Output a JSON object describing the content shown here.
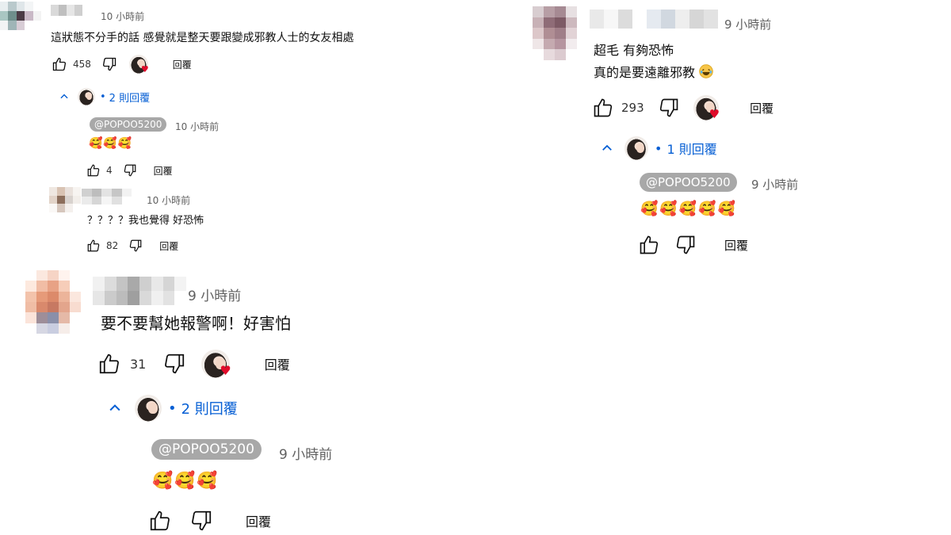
{
  "left_column": {
    "thread1": {
      "time": "10 小時前",
      "text": "這狀態不分手的話 感覺就是整天要跟變成邪教人士的女友相處",
      "likes": "458",
      "reply_label": "回覆",
      "replies_toggle": "2 則回覆",
      "reply1": {
        "handle": "@POPOO5200",
        "time": "10 小時前",
        "emoji": "🥰🥰🥰",
        "likes": "4",
        "reply_label": "回覆"
      },
      "reply2": {
        "time": "10 小時前",
        "text": "？？？？我也覺得 好恐怖",
        "likes": "82",
        "reply_label": "回覆"
      }
    },
    "thread2": {
      "time": "9 小時前",
      "text": "要不要幫她報警啊！好害怕",
      "likes": "31",
      "reply_label": "回覆",
      "replies_toggle": "2 則回覆",
      "reply1": {
        "handle": "@POPOO5200",
        "time": "9 小時前",
        "emoji": "🥰🥰🥰",
        "reply_label": "回覆"
      }
    }
  },
  "right_column": {
    "thread3": {
      "time": "9 小時前",
      "text_line1": "超毛 有夠恐怖",
      "text_line2": "真的是要遠離邪教",
      "likes": "293",
      "reply_label": "回覆",
      "replies_toggle": "1 則回覆",
      "reply1": {
        "handle": "@POPOO5200",
        "time": "9 小時前",
        "emoji": "🥰🥰🥰🥰🥰",
        "reply_label": "回覆"
      }
    }
  },
  "icons": {
    "like": "thumb-up-icon",
    "dislike": "thumb-down-icon",
    "collapse": "chevron-up-icon",
    "heart": "heart-icon",
    "laugh": "laughing-emoji"
  },
  "colors": {
    "link": "#065fd4",
    "muted": "#606060",
    "handle_bg": "#a8a8a8",
    "heart": "#e00b2a"
  }
}
